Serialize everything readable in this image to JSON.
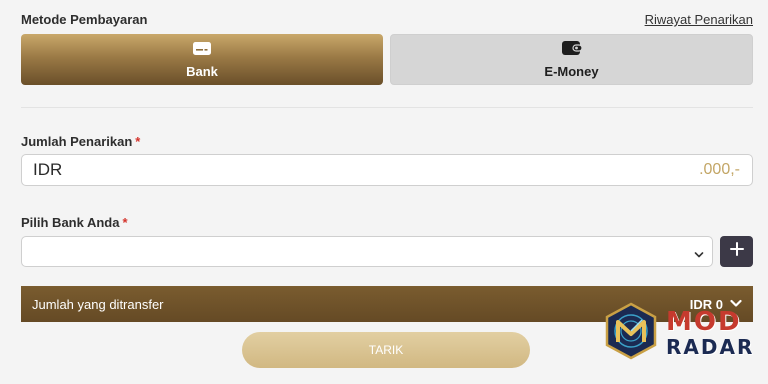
{
  "payment": {
    "section_label": "Metode Pembayaran",
    "history_link": "Riwayat Penarikan",
    "bank_label": "Bank",
    "bank_icon": "card-icon",
    "emoney_label": "E-Money",
    "emoney_icon": "wallet-icon"
  },
  "amount": {
    "label": "Jumlah Penarikan",
    "required_mark": "*",
    "prefix": "IDR",
    "suffix": ".000,-"
  },
  "bank": {
    "label": "Pilih Bank Anda",
    "required_mark": "*",
    "selected_value": "",
    "add_icon": "plus-icon"
  },
  "transfer": {
    "label": "Jumlah yang ditransfer",
    "value": "IDR 0",
    "icon": "chevron-down-icon"
  },
  "submit": {
    "label": "TARIK"
  },
  "watermark": {
    "line1": "MOD",
    "line2": "RADAR"
  },
  "colors": {
    "accent_gold_top": "#c9a86a",
    "accent_gold_bottom": "#6a4f29",
    "transfer_bar": "#6f5229",
    "add_button": "#3c3947",
    "required": "#d4332b",
    "submit_button": "#d9c392",
    "inactive_button": "#d6d6d6"
  }
}
